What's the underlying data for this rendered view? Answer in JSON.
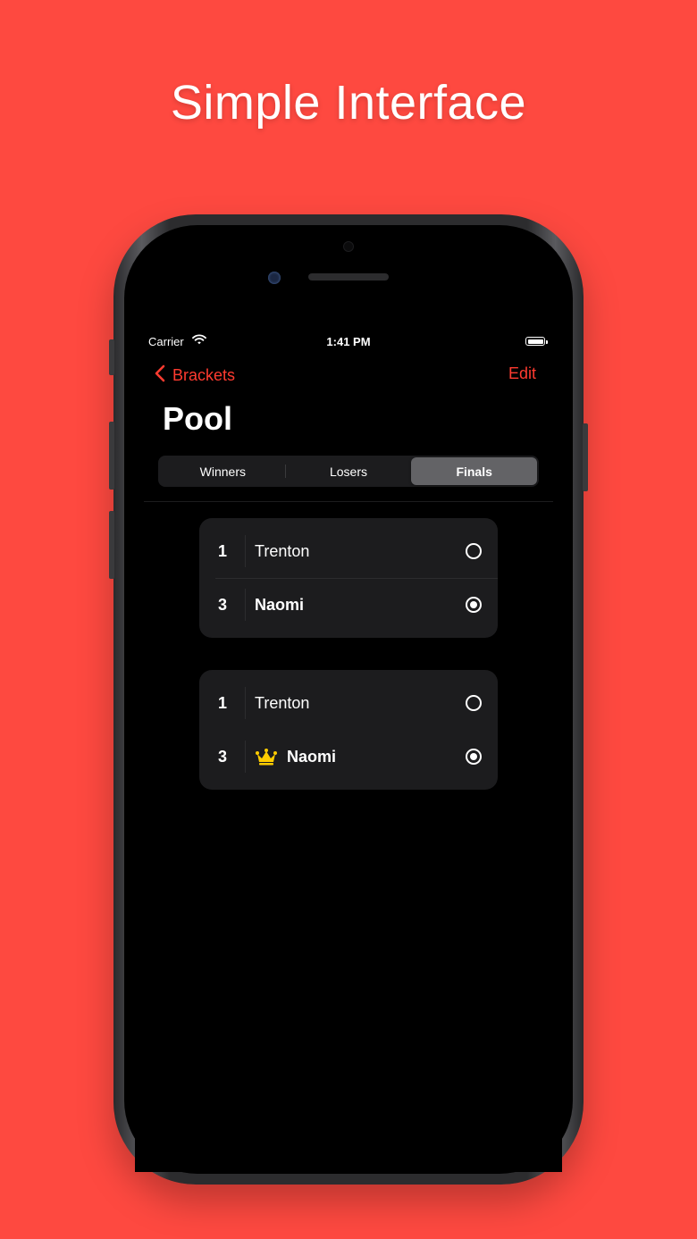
{
  "headline": "Simple Interface",
  "status_bar": {
    "carrier": "Carrier",
    "time": "1:41 PM"
  },
  "nav": {
    "back_label": "Brackets",
    "edit_label": "Edit"
  },
  "page_title": "Pool",
  "tabs": [
    {
      "label": "Winners",
      "selected": false
    },
    {
      "label": "Losers",
      "selected": false
    },
    {
      "label": "Finals",
      "selected": true
    }
  ],
  "matches": [
    {
      "rows": [
        {
          "seed": "1",
          "name": "Trenton",
          "selected": false,
          "winner": false
        },
        {
          "seed": "3",
          "name": "Naomi",
          "selected": true,
          "winner": false
        }
      ]
    },
    {
      "rows": [
        {
          "seed": "1",
          "name": "Trenton",
          "selected": false,
          "winner": false
        },
        {
          "seed": "3",
          "name": "Naomi",
          "selected": true,
          "winner": true
        }
      ]
    }
  ],
  "colors": {
    "background": "#fe4940",
    "accent": "#ff3b30",
    "crown": "#ffcc00"
  }
}
